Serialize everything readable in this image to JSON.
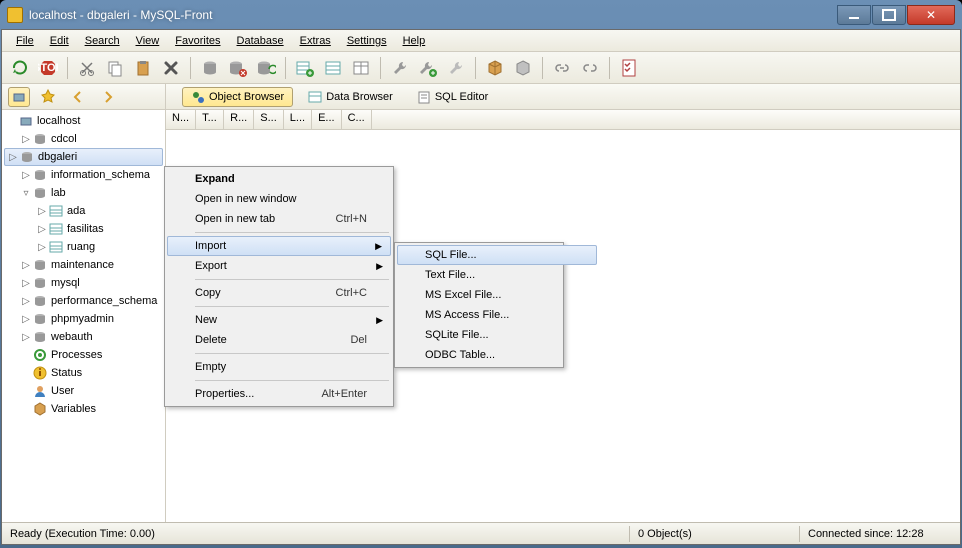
{
  "title": "localhost - dbgaleri - MySQL-Front",
  "menubar": [
    "File",
    "Edit",
    "Search",
    "View",
    "Favorites",
    "Database",
    "Extras",
    "Settings",
    "Help"
  ],
  "viewtabs": [
    {
      "label": "Object Browser",
      "active": true
    },
    {
      "label": "Data Browser",
      "active": false
    },
    {
      "label": "SQL Editor",
      "active": false
    }
  ],
  "columns": [
    "N...",
    "T...",
    "R...",
    "S...",
    "L...",
    "E...",
    "C..."
  ],
  "tree": {
    "root": "localhost",
    "items": [
      {
        "label": "cdcol",
        "lvl": 1,
        "tw": "▷",
        "kind": "db"
      },
      {
        "label": "dbgaleri",
        "lvl": 1,
        "tw": "▷",
        "kind": "db",
        "sel": true
      },
      {
        "label": "information_schema",
        "lvl": 1,
        "tw": "▷",
        "kind": "db"
      },
      {
        "label": "lab",
        "lvl": 1,
        "tw": "▿",
        "kind": "db"
      },
      {
        "label": "ada",
        "lvl": 2,
        "tw": "▷",
        "kind": "tbl"
      },
      {
        "label": "fasilitas",
        "lvl": 2,
        "tw": "▷",
        "kind": "tbl"
      },
      {
        "label": "ruang",
        "lvl": 2,
        "tw": "▷",
        "kind": "tbl"
      },
      {
        "label": "maintenance",
        "lvl": 1,
        "tw": "▷",
        "kind": "db"
      },
      {
        "label": "mysql",
        "lvl": 1,
        "tw": "▷",
        "kind": "db"
      },
      {
        "label": "performance_schema",
        "lvl": 1,
        "tw": "▷",
        "kind": "db"
      },
      {
        "label": "phpmyadmin",
        "lvl": 1,
        "tw": "▷",
        "kind": "db"
      },
      {
        "label": "webauth",
        "lvl": 1,
        "tw": "▷",
        "kind": "db"
      },
      {
        "label": "Processes",
        "lvl": 1,
        "tw": "",
        "kind": "proc"
      },
      {
        "label": "Status",
        "lvl": 1,
        "tw": "",
        "kind": "stat"
      },
      {
        "label": "User",
        "lvl": 1,
        "tw": "",
        "kind": "user"
      },
      {
        "label": "Variables",
        "lvl": 1,
        "tw": "",
        "kind": "var"
      }
    ]
  },
  "context_main": [
    {
      "label": "Expand",
      "bold": true
    },
    {
      "label": "Open in new window"
    },
    {
      "label": "Open in new tab",
      "shortcut": "Ctrl+N"
    },
    {
      "sep": true
    },
    {
      "label": "Import",
      "sub": true,
      "hl": true
    },
    {
      "label": "Export",
      "sub": true
    },
    {
      "sep": true
    },
    {
      "label": "Copy",
      "shortcut": "Ctrl+C"
    },
    {
      "sep": true
    },
    {
      "label": "New",
      "sub": true
    },
    {
      "label": "Delete",
      "shortcut": "Del"
    },
    {
      "sep": true
    },
    {
      "label": "Empty"
    },
    {
      "sep": true
    },
    {
      "label": "Properties...",
      "shortcut": "Alt+Enter"
    }
  ],
  "context_sub": [
    {
      "label": "SQL File...",
      "hl": true
    },
    {
      "label": "Text File..."
    },
    {
      "label": "MS Excel File..."
    },
    {
      "label": "MS Access File..."
    },
    {
      "label": "SQLite File..."
    },
    {
      "label": "ODBC Table..."
    }
  ],
  "statusbar": {
    "left": "Ready   (Execution Time: 0.00)",
    "mid": "0 Object(s)",
    "right": "Connected since: 12:28"
  }
}
